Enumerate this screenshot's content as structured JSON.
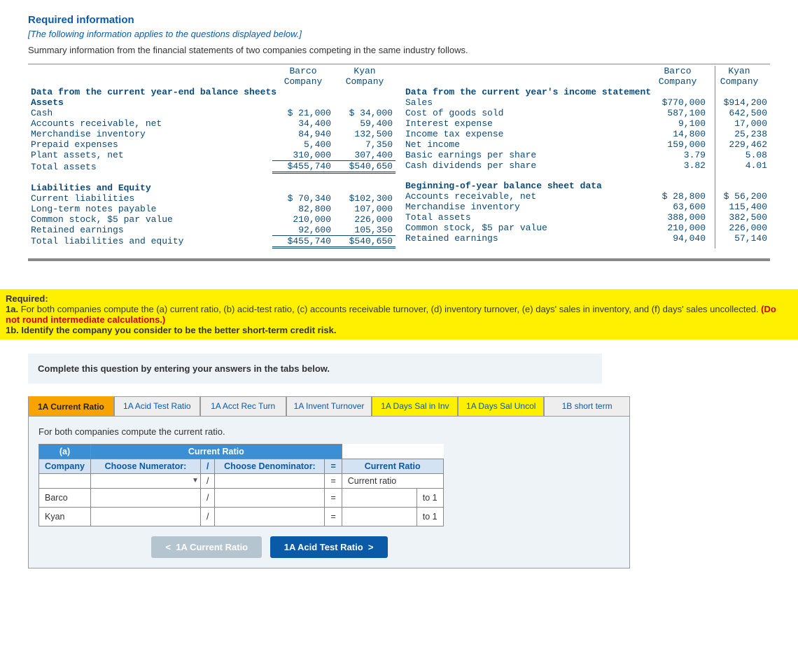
{
  "header": {
    "title": "Required information",
    "subtitle": "[The following information applies to the questions displayed below.]",
    "summary": "Summary information from the financial statements of two companies competing in the same industry follows."
  },
  "fin": {
    "col1": "Barco Company",
    "col2": "Kyan Company",
    "left_title": "Data from the current year-end balance sheets",
    "assets_h": "Assets",
    "assets": [
      {
        "l": "Cash",
        "b": "$ 21,000",
        "k": "$ 34,000"
      },
      {
        "l": "Accounts receivable, net",
        "b": "34,400",
        "k": "59,400"
      },
      {
        "l": "Merchandise inventory",
        "b": "84,940",
        "k": "132,500"
      },
      {
        "l": "Prepaid expenses",
        "b": "5,400",
        "k": "7,350"
      },
      {
        "l": "Plant assets, net",
        "b": "310,000",
        "k": "307,400"
      }
    ],
    "assets_total": {
      "l": "Total assets",
      "b": "$455,740",
      "k": "$540,650"
    },
    "liab_h": "Liabilities and Equity",
    "liab": [
      {
        "l": "Current liabilities",
        "b": "$ 70,340",
        "k": "$102,300"
      },
      {
        "l": "Long-term notes payable",
        "b": "82,800",
        "k": "107,000"
      },
      {
        "l": "Common stock, $5 par value",
        "b": "210,000",
        "k": "226,000"
      },
      {
        "l": "Retained earnings",
        "b": "92,600",
        "k": "105,350"
      }
    ],
    "liab_total": {
      "l": "Total liabilities and equity",
      "b": "$455,740",
      "k": "$540,650"
    },
    "right_title": "Data from the current year's income statement",
    "income": [
      {
        "l": "Sales",
        "b": "$770,000",
        "k": "$914,200"
      },
      {
        "l": "Cost of goods sold",
        "b": "587,100",
        "k": "642,500"
      },
      {
        "l": "Interest expense",
        "b": "9,100",
        "k": "17,000"
      },
      {
        "l": "Income tax expense",
        "b": "14,800",
        "k": "25,238"
      },
      {
        "l": "Net income",
        "b": "159,000",
        "k": "229,462"
      },
      {
        "l": "Basic earnings per share",
        "b": "3.79",
        "k": "5.08"
      },
      {
        "l": "Cash dividends per share",
        "b": "3.82",
        "k": "4.01"
      }
    ],
    "boy_h": "Beginning-of-year balance sheet data",
    "boy": [
      {
        "l": "Accounts receivable, net",
        "b": "$ 28,800",
        "k": "$ 56,200"
      },
      {
        "l": "Merchandise inventory",
        "b": "63,600",
        "k": "115,400"
      },
      {
        "l": "Total assets",
        "b": "388,000",
        "k": "382,500"
      },
      {
        "l": "Common stock, $5 par value",
        "b": "210,000",
        "k": "226,000"
      },
      {
        "l": "Retained earnings",
        "b": "94,040",
        "k": "57,140"
      }
    ]
  },
  "required": {
    "head": "Required:",
    "line1a": "1a. ",
    "line1b": "For both companies compute the (a) current ratio, (b) acid-test ratio, (c) accounts receivable turnover, (d) inventory turnover, (e) days' sales in inventory, and (f) days' sales uncollected. ",
    "noround": "(Do not round intermediate calculations.)",
    "line2": "1b. Identify the company you consider to be the better short-term credit risk."
  },
  "instruction": "Complete this question by entering your answers in the tabs below.",
  "tabs": [
    "1A Current Ratio",
    "1A Acid Test Ratio",
    "1A Acct Rec Turn",
    "1A Invent Turnover",
    "1A Days Sal in Inv",
    "1A Days Sal Uncol",
    "1B short term"
  ],
  "panel": {
    "prompt": "For both companies compute the current ratio.",
    "a": "(a)",
    "company": "Company",
    "ratio_h": "Current Ratio",
    "num_h": "Choose Numerator:",
    "den_h": "Choose Denominator:",
    "slash": "/",
    "eq": "=",
    "cr": "Current Ratio",
    "cr_lower": "Current ratio",
    "to1": "to 1",
    "r1": "Barco",
    "r2": "Kyan"
  },
  "nav": {
    "prev": "1A Current Ratio",
    "next": "1A Acid Test Ratio"
  }
}
